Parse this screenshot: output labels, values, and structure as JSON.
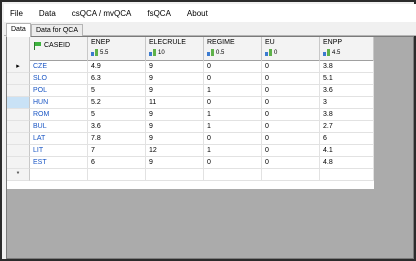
{
  "menu": [
    "File",
    "Data",
    "csQCA / mvQCA",
    "fsQCA",
    "About"
  ],
  "tabs": [
    {
      "label": "Data",
      "active": true
    },
    {
      "label": "Data for QCA",
      "active": false
    }
  ],
  "grid": {
    "columns": [
      {
        "name": "CASEID",
        "icon": "flag-icon",
        "avg": ""
      },
      {
        "name": "ENEP",
        "icon": "bar-chart-icon",
        "avg": "5.5"
      },
      {
        "name": "ELECRULE",
        "icon": "bar-chart-icon",
        "avg": "10"
      },
      {
        "name": "REGIME",
        "icon": "bar-chart-icon",
        "avg": "0.5"
      },
      {
        "name": "EU",
        "icon": "bar-chart-icon",
        "avg": "0"
      },
      {
        "name": "ENPP",
        "icon": "bar-chart-icon",
        "avg": "4.5"
      }
    ],
    "rows": [
      [
        "CZE",
        "4.9",
        "9",
        "0",
        "0",
        "3.8"
      ],
      [
        "SLO",
        "6.3",
        "9",
        "0",
        "0",
        "5.1"
      ],
      [
        "POL",
        "5",
        "9",
        "1",
        "0",
        "3.6"
      ],
      [
        "HUN",
        "5.2",
        "11",
        "0",
        "0",
        "3"
      ],
      [
        "ROM",
        "5",
        "9",
        "1",
        "0",
        "3.8"
      ],
      [
        "BUL",
        "3.6",
        "9",
        "1",
        "0",
        "2.7"
      ],
      [
        "LAT",
        "7.8",
        "9",
        "0",
        "0",
        "6"
      ],
      [
        "LIT",
        "7",
        "12",
        "1",
        "0",
        "4.1"
      ],
      [
        "EST",
        "6",
        "9",
        "0",
        "0",
        "4.8"
      ]
    ],
    "current_row_marker": "▸",
    "new_row_marker": "*",
    "current_row_index": 0,
    "selected_row_index": 3,
    "caseid_color": "#1a56c4",
    "selection_color": "#c9e2f6"
  }
}
